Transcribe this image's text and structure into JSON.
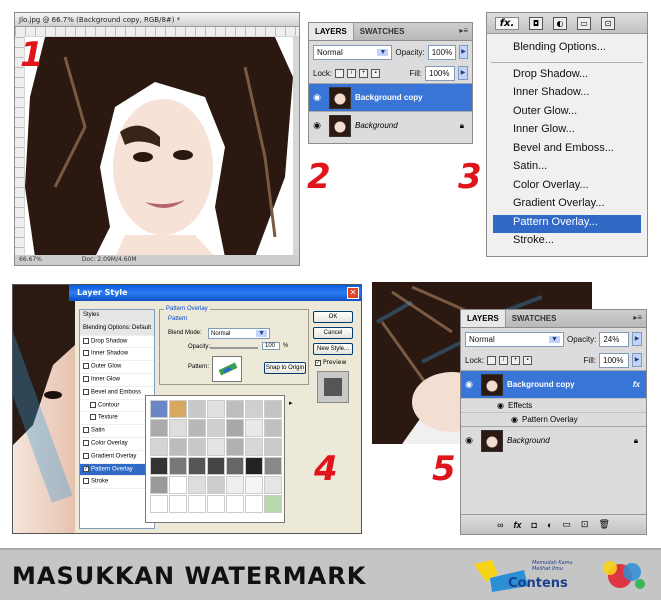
{
  "steps": {
    "s1": "1",
    "s2": "2",
    "s3": "3",
    "s4": "4",
    "s5": "5"
  },
  "doc_window": {
    "title": "Jlo.jpg @ 66.7% (Background copy, RGB/8#) *",
    "zoom": "66.67%",
    "doc_size": "Doc: 2.09M/4.60M"
  },
  "layers_panel_2": {
    "tab_layers": "LAYERS",
    "tab_swatches": "SWATCHES",
    "blend_mode": "Normal",
    "opacity_label": "Opacity:",
    "opacity_value": "100%",
    "lock_label": "Lock:",
    "fill_label": "Fill:",
    "fill_value": "100%",
    "layer1": "Background copy",
    "layer2": "Background"
  },
  "fx_menu": {
    "fx_label": "fx.",
    "blending": "Blending Options...",
    "items": [
      "Drop Shadow...",
      "Inner Shadow...",
      "Outer Glow...",
      "Inner Glow...",
      "Bevel and Emboss...",
      "Satin...",
      "Color Overlay...",
      "Gradient Overlay...",
      "Pattern Overlay...",
      "Stroke..."
    ]
  },
  "layer_style": {
    "title": "Layer Style",
    "styles_header": "Styles",
    "blending_default": "Blending Options: Default",
    "style_items": [
      "Drop Shadow",
      "Inner Shadow",
      "Outer Glow",
      "Inner Glow",
      "Bevel and Emboss",
      "Contour",
      "Texture",
      "Satin",
      "Color Overlay",
      "Gradient Overlay",
      "Pattern Overlay",
      "Stroke"
    ],
    "group_title": "Pattern Overlay",
    "subgroup": "Pattern",
    "blend_mode_label": "Blend Mode:",
    "blend_mode_value": "Normal",
    "opacity_label": "Opacity:",
    "opacity_value": "100",
    "opacity_unit": "%",
    "pattern_label": "Pattern:",
    "snap_button": "Snap to Origin",
    "ok": "OK",
    "cancel": "Cancel",
    "new_style": "New Style...",
    "preview": "Preview"
  },
  "layers_panel_5": {
    "tab_layers": "LAYERS",
    "tab_swatches": "SWATCHES",
    "blend_mode": "Normal",
    "opacity_label": "Opacity:",
    "opacity_value": "24%",
    "lock_label": "Lock:",
    "fill_label": "Fill:",
    "fill_value": "100%",
    "layer1": "Background copy",
    "effects": "Effects",
    "pattern_overlay": "Pattern Overlay",
    "layer2": "Background",
    "fx_badge": "fx"
  },
  "banner": {
    "text": "MASUKKAN WATERMARK",
    "logo_text": "Contens",
    "logo_tagline": "Memudah Kamu Melihat Ilmu"
  },
  "colors": {
    "step_red": "#e0141b",
    "selection_blue": "#3875d7",
    "banner_gray": "#c5c5c5"
  }
}
